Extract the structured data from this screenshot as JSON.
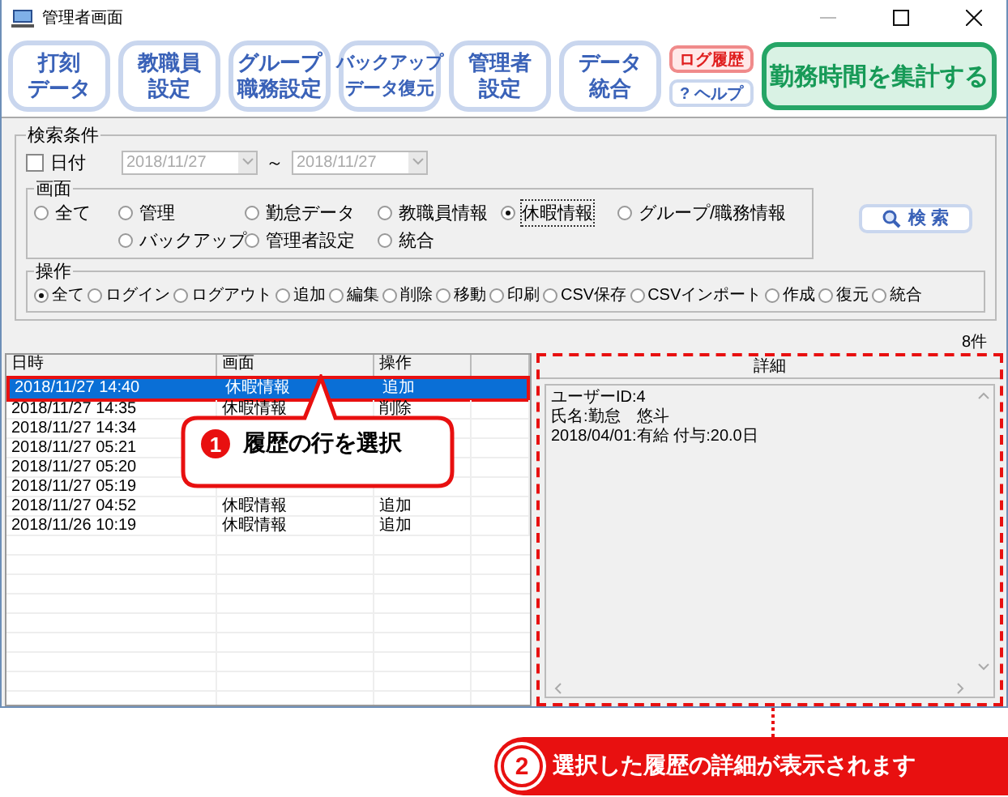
{
  "window": {
    "title": "管理者画面"
  },
  "toolbar": {
    "buttons": [
      {
        "lines": [
          "打刻",
          "データ"
        ]
      },
      {
        "lines": [
          "教職員",
          "設定"
        ]
      },
      {
        "lines": [
          "グループ",
          "職務設定"
        ]
      },
      {
        "lines": [
          "バックアップ",
          "データ復元"
        ]
      },
      {
        "lines": [
          "管理者",
          "設定"
        ]
      },
      {
        "lines": [
          "データ",
          "統合"
        ]
      }
    ],
    "log_button": "ログ履歴",
    "help_button": "? ヘルプ",
    "aggregate_button": "勤務時間を集計する"
  },
  "search": {
    "title": "検索条件",
    "date": {
      "checked": false,
      "label": "日付",
      "from": "2018/11/27",
      "separator": "～",
      "to": "2018/11/27"
    },
    "screen_group": {
      "title": "画面",
      "options": [
        {
          "label": "全て",
          "selected": false
        },
        {
          "label": "管理",
          "selected": false
        },
        {
          "label": "勤怠データ",
          "selected": false
        },
        {
          "label": "教職員情報",
          "selected": false
        },
        {
          "label": "休暇情報",
          "selected": true
        },
        {
          "label": "グループ/職務情報",
          "selected": false
        },
        {
          "label": "バックアップ",
          "selected": false
        },
        {
          "label": "管理者設定",
          "selected": false
        },
        {
          "label": "統合",
          "selected": false
        }
      ]
    },
    "operation_group": {
      "title": "操作",
      "options": [
        {
          "label": "全て",
          "selected": true
        },
        {
          "label": "ログイン",
          "selected": false
        },
        {
          "label": "ログアウト",
          "selected": false
        },
        {
          "label": "追加",
          "selected": false
        },
        {
          "label": "編集",
          "selected": false
        },
        {
          "label": "削除",
          "selected": false
        },
        {
          "label": "移動",
          "selected": false
        },
        {
          "label": "印刷",
          "selected": false
        },
        {
          "label": "CSV保存",
          "selected": false
        },
        {
          "label": "CSVインポート",
          "selected": false
        },
        {
          "label": "作成",
          "selected": false
        },
        {
          "label": "復元",
          "selected": false
        },
        {
          "label": "統合",
          "selected": false
        }
      ]
    },
    "search_button": "検 索"
  },
  "count": "8件",
  "table": {
    "columns": [
      "日時",
      "画面",
      "操作"
    ],
    "rows": [
      {
        "datetime": "2018/11/27 14:40",
        "screen": "休暇情報",
        "operation": "追加",
        "selected": true
      },
      {
        "datetime": "2018/11/27 14:35",
        "screen": "休暇情報",
        "operation": "削除",
        "selected": false
      },
      {
        "datetime": "2018/11/27 14:34",
        "selected": false
      },
      {
        "datetime": "2018/11/27 05:21",
        "selected": false
      },
      {
        "datetime": "2018/11/27 05:20",
        "selected": false
      },
      {
        "datetime": "2018/11/27 05:19",
        "selected": false
      },
      {
        "datetime": "2018/11/27 04:52",
        "screen": "休暇情報",
        "operation": "追加",
        "selected": false
      },
      {
        "datetime": "2018/11/26 10:19",
        "screen": "休暇情報",
        "operation": "追加",
        "selected": false
      }
    ]
  },
  "detail": {
    "title": "詳細",
    "lines": [
      "ユーザーID:4",
      "氏名:勤怠　悠斗",
      "2018/04/01:有給 付与:20.0日"
    ]
  },
  "callouts": [
    {
      "number": "1",
      "text": "履歴の行を選択"
    },
    {
      "number": "2",
      "text": "選択した履歴の詳細が表示されます"
    }
  ]
}
